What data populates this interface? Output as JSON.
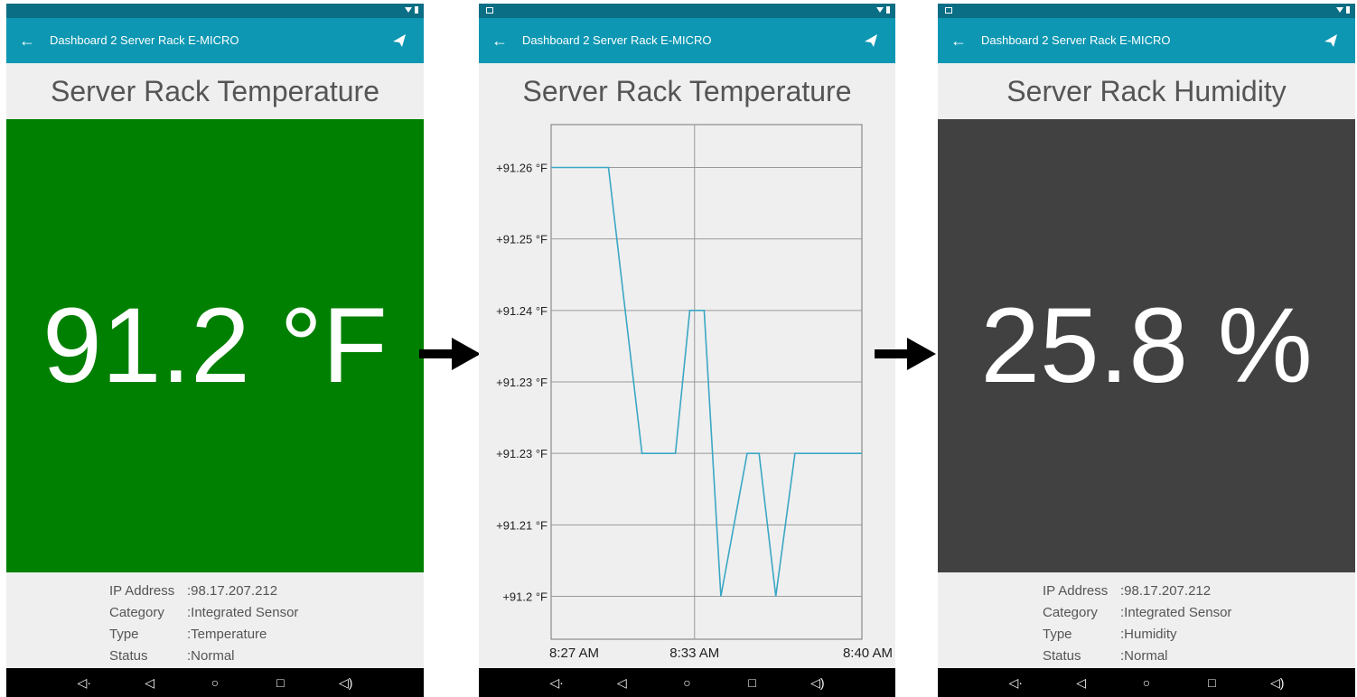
{
  "screens": [
    {
      "appbar_title": "Dashboard 2 Server Rack E-MICRO",
      "heading": "Server Rack Temperature",
      "value": "91.2 °F",
      "info": {
        "ip_label": "IP Address",
        "ip_value": ":98.17.207.212",
        "category_label": "Category",
        "category_value": ":Integrated Sensor",
        "type_label": "Type",
        "type_value": ":Temperature",
        "status_label": "Status",
        "status_value": ":Normal"
      },
      "tile_color": "#008000"
    },
    {
      "appbar_title": "Dashboard 2 Server Rack E-MICRO",
      "heading": "Server Rack Temperature"
    },
    {
      "appbar_title": "Dashboard 2 Server Rack E-MICRO",
      "heading": "Server Rack Humidity",
      "value": "25.8 %",
      "info": {
        "ip_label": "IP Address",
        "ip_value": ":98.17.207.212",
        "category_label": "Category",
        "category_value": ":Integrated Sensor",
        "type_label": "Type",
        "type_value": ":Humidity",
        "status_label": "Status",
        "status_value": ":Normal"
      },
      "tile_color": "#414141"
    }
  ],
  "icons": {
    "back": "arrow-left-icon",
    "action": "send-icon",
    "nav": [
      "volume-down-icon",
      "back-triangle-icon",
      "home-circle-icon",
      "recents-square-icon",
      "volume-up-icon"
    ],
    "flow_arrow": "right-arrow-icon"
  },
  "colors": {
    "statusbar": "#0a6e84",
    "appbar": "#0d97b3",
    "line": "#3aa7c4"
  },
  "chart_data": {
    "type": "line",
    "title": "Server Rack Temperature",
    "y_tick_labels": [
      "+91.26 °F",
      "+91.25 °F",
      "+91.24 °F",
      "+91.23 °F",
      "+91.23 °F",
      "+91.21 °F",
      "+91.2 °F"
    ],
    "y_tick_values": [
      91.26,
      91.25,
      91.24,
      91.23,
      91.22,
      91.21,
      91.2
    ],
    "x_tick_labels": [
      "8:27 AM",
      "8:33 AM",
      "8:40 AM"
    ],
    "x_tick_minutes": [
      0,
      6,
      13
    ],
    "ylim": [
      91.194,
      91.266
    ],
    "grid": true,
    "series": [
      {
        "x": [
          0,
          1.2,
          2.4,
          3.1,
          3.8,
          4.6,
          5.2,
          5.8,
          6.4,
          7.1,
          8.2,
          8.7,
          9.4,
          10.2,
          10.9,
          11.6,
          12.4,
          13
        ],
        "y": [
          91.26,
          91.26,
          91.26,
          91.24,
          91.22,
          91.22,
          91.22,
          91.24,
          91.24,
          91.2,
          91.22,
          91.22,
          91.2,
          91.22,
          91.22,
          91.22,
          91.22,
          91.22
        ]
      }
    ]
  }
}
